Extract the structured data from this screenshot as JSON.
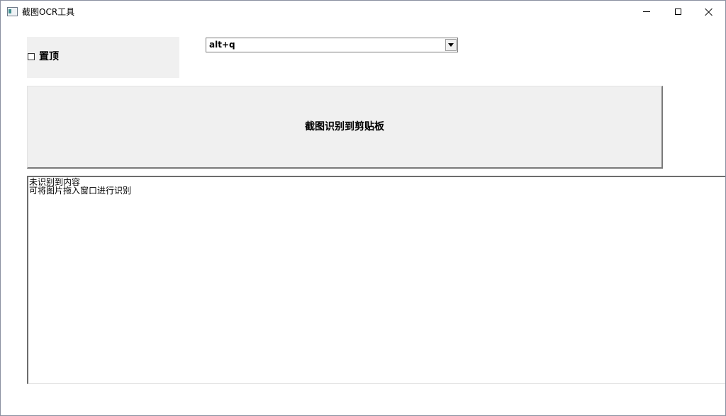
{
  "window": {
    "title": "截图OCR工具",
    "icon": "app-window-icon"
  },
  "titlebar": {
    "minimize_icon": "minimize-icon",
    "maximize_icon": "maximize-icon",
    "close_icon": "close-icon"
  },
  "pin": {
    "label": "置顶",
    "checked": false
  },
  "hotkey": {
    "selected": "alt+q"
  },
  "capture_button": {
    "label": "截图识别到剪贴板"
  },
  "result": {
    "lines": [
      "未识别到内容",
      "可将图片拖入窗口进行识别"
    ]
  }
}
